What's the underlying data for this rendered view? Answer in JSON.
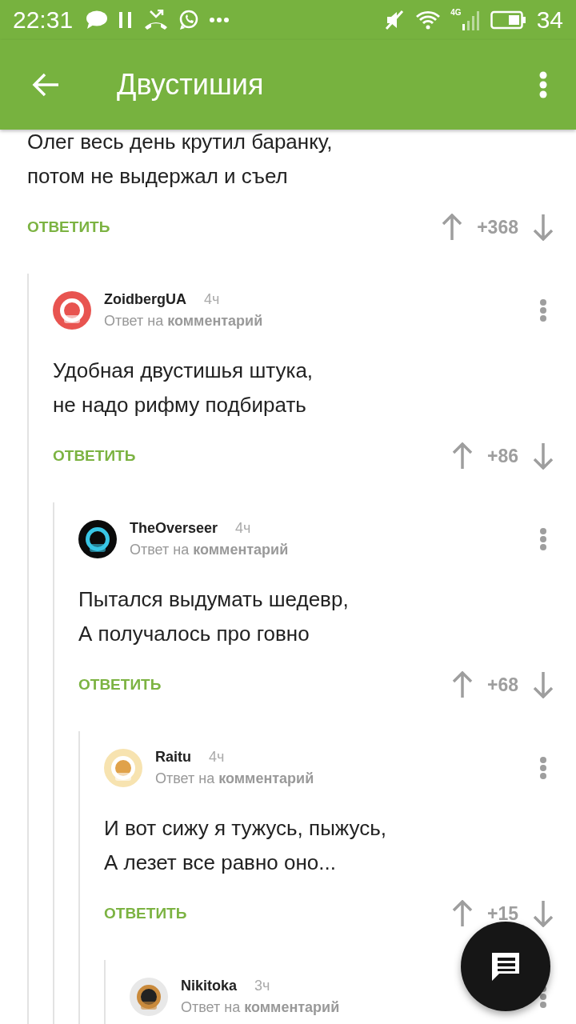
{
  "status_bar": {
    "time": "22:31",
    "network": "4G",
    "battery": "34"
  },
  "app_bar": {
    "title": "Двустишия"
  },
  "thread": {
    "lines": [
      "Олег весь день крутил баранку,",
      "потом не выдержал и съел"
    ],
    "reply": "ОТВЕТИТЬ",
    "score": "+368",
    "children": [
      {
        "author": "ZoidbergUA",
        "time": "4ч",
        "subtitle": "Ответ на **комментарий**",
        "avatar": {
          "kind": "picture"
        },
        "lines": [
          "Удобная двустишья штука,",
          "не надо рифму подбирать"
        ],
        "reply": "ОТВЕТИТЬ",
        "score": "+86",
        "children": [
          {
            "author": "TheOverseer",
            "time": "4ч",
            "subtitle": "Ответ на **комментарий**",
            "avatar": {
              "kind": "picture"
            },
            "lines": [
              "Пытался выдумать шедевр,",
              "А получалось про говно"
            ],
            "reply": "ОТВЕТИТЬ",
            "score": "+68",
            "children": [
              {
                "author": "Raitu",
                "time": "4ч",
                "subtitle": "Ответ на **комментарий**",
                "avatar": {
                  "kind": "picture"
                },
                "lines": [
                  "И вот сижу я тужусь, пыжусь,",
                  "А лезет все равно оно..."
                ],
                "reply": "ОТВЕТИТЬ",
                "score": "+15",
                "children": [
                  {
                    "author": "Nikitoka",
                    "time": "3ч",
                    "subtitle": "Ответ на **комментарий**",
                    "avatar": {
                      "kind": "picture"
                    }
                  }
                ]
              }
            ]
          }
        ]
      }
    ]
  }
}
